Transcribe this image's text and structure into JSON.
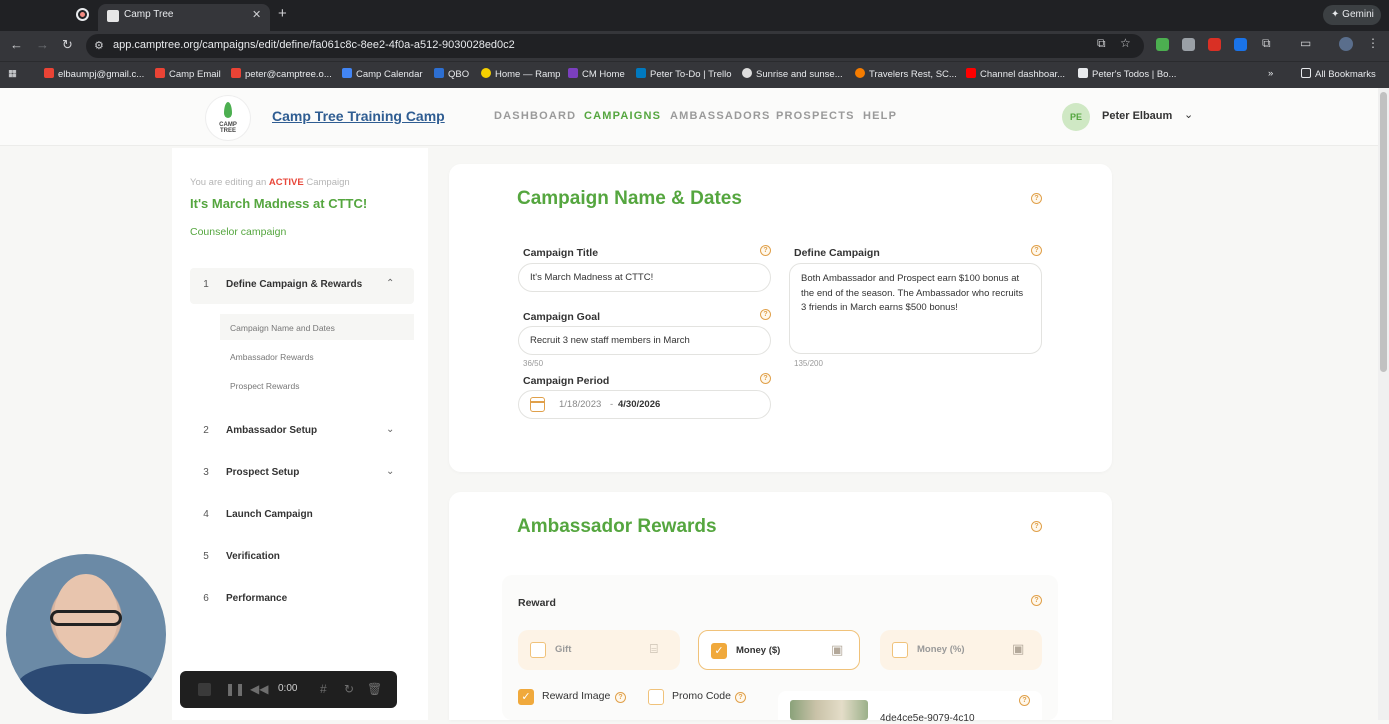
{
  "browser": {
    "tab_title": "Camp Tree",
    "url_text": "app.camptree.org/campaigns/edit/define/fa061c8c-8ee2-4f0a-a512-9030028ed0c2",
    "gemini_label": "Gemini",
    "bookmarks": [
      "elbaumpj@gmail.c...",
      "Camp Email",
      "peter@camptree.o...",
      "Camp Calendar",
      "QBO",
      "Home — Ramp",
      "CM Home",
      "Peter To-Do | Trello",
      "Sunrise and sunse...",
      "Travelers Rest, SC...",
      "Channel dashboar...",
      "Peter's Todos | Bo..."
    ],
    "all_bookmarks_label": "All Bookmarks"
  },
  "header": {
    "logo_text": "CAMP TREE",
    "camp_name": "Camp Tree Training Camp",
    "nav": [
      "DASHBOARD",
      "CAMPAIGNS",
      "AMBASSADORS",
      "PROSPECTS",
      "HELP"
    ],
    "active_nav": "CAMPAIGNS",
    "user_initials": "PE",
    "user_name": "Peter Elbaum"
  },
  "sidebar": {
    "edit_prefix": "You are editing an",
    "edit_status": "ACTIVE",
    "edit_suffix": "Campaign",
    "campaign_title": "It's March Madness at CTTC!",
    "campaign_type": "Counselor campaign",
    "steps": [
      {
        "num": "1",
        "label": "Define Campaign & Rewards"
      },
      {
        "num": "2",
        "label": "Ambassador Setup"
      },
      {
        "num": "3",
        "label": "Prospect Setup"
      },
      {
        "num": "4",
        "label": "Launch Campaign"
      },
      {
        "num": "5",
        "label": "Verification"
      },
      {
        "num": "6",
        "label": "Performance"
      }
    ],
    "substeps": [
      "Campaign Name and Dates",
      "Ambassador Rewards",
      "Prospect Rewards"
    ]
  },
  "name_dates": {
    "title": "Campaign Name & Dates",
    "campaign_title_label": "Campaign Title",
    "campaign_title_value": "It's March Madness at CTTC!",
    "goal_label": "Campaign Goal",
    "goal_value": "Recruit 3 new staff members in March",
    "goal_counter": "36/50",
    "period_label": "Campaign Period",
    "period_start": "1/18/2023",
    "period_sep": "-",
    "period_end": "4/30/2026",
    "define_label": "Define Campaign",
    "define_value": "Both Ambassador and Prospect earn $100 bonus at the end of the season. The Ambassador who recruits 3 friends in March earns $500 bonus!",
    "define_counter": "135/200"
  },
  "ambassador_rewards": {
    "title": "Ambassador Rewards",
    "reward_label": "Reward",
    "options": [
      {
        "label": "Gift",
        "checked": false
      },
      {
        "label": "Money ($)",
        "checked": true
      },
      {
        "label": "Money (%)",
        "checked": false
      }
    ],
    "reward_image_label": "Reward Image",
    "reward_image_checked": true,
    "promo_code_label": "Promo Code",
    "promo_code_checked": false,
    "image_filename": "4de4ce5e-9079-4c10"
  },
  "recorder": {
    "time": "0:00"
  },
  "colors": {
    "brand_green": "#55a63f",
    "link_blue": "#2f5d92",
    "accent_orange": "#f0a93c",
    "status_red": "#e8473a"
  }
}
